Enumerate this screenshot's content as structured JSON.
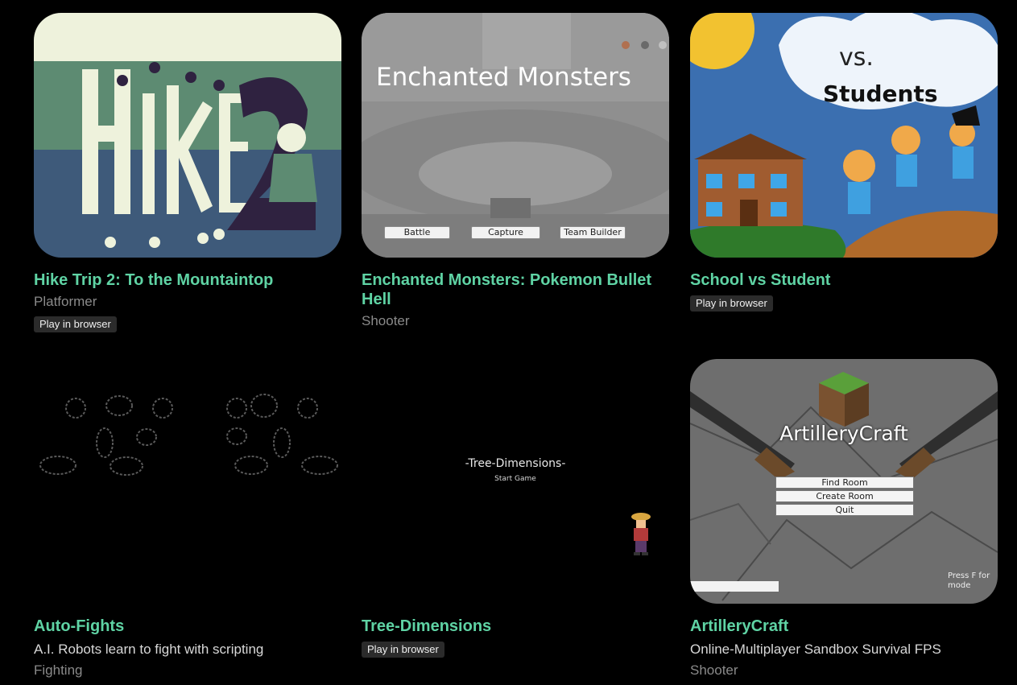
{
  "games": [
    {
      "title": "Hike Trip 2: To the Mountaintop",
      "genre": "Platformer",
      "badge": "Play in browser"
    },
    {
      "title": "Enchanted Monsters: Pokemon Bullet Hell",
      "genre": "Shooter",
      "thumb": {
        "title": "Enchanted Monsters",
        "buttons": [
          "Battle",
          "Capture",
          "Team Builder"
        ]
      }
    },
    {
      "title": "School vs Student",
      "badge": "Play in browser"
    },
    {
      "title": "Auto-Fights",
      "description": "A.I. Robots learn to fight with scripting",
      "genre": "Fighting"
    },
    {
      "title": "Tree-Dimensions",
      "badge": "Play in browser",
      "thumb": {
        "title": "-Tree-Dimensions-",
        "start": "Start Game"
      }
    },
    {
      "title": "ArtilleryCraft",
      "description": "Online-Multiplayer Sandbox Survival FPS",
      "genre": "Shooter",
      "thumb": {
        "title": "ArtilleryCraft",
        "buttons": [
          "Find Room",
          "Create Room",
          "Quit"
        ],
        "hint": "Press F for mode"
      }
    }
  ],
  "colors": {
    "background": "#000000",
    "title": "#5fd3a4",
    "genre": "#8a8a8a",
    "badge_bg": "#2b2b2b"
  }
}
